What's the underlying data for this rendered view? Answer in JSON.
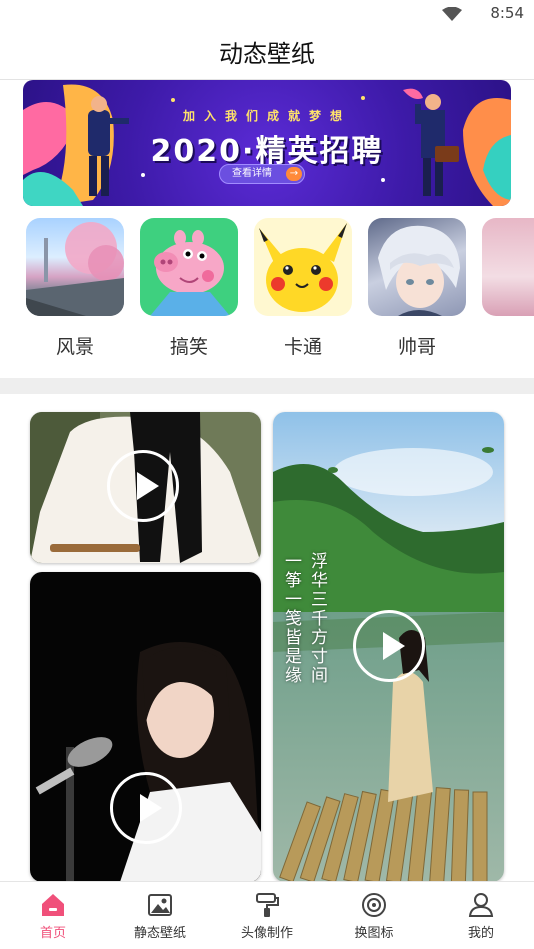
{
  "status_bar": {
    "time": "8:54"
  },
  "header": {
    "title": "动态壁纸"
  },
  "banner": {
    "subtitle": "加入我们成就梦想",
    "headline": "2020·精英招聘",
    "button_label": "查看详情"
  },
  "categories": [
    {
      "label": "风景",
      "icon": "landscape-thumb"
    },
    {
      "label": "搞笑",
      "icon": "peppa-pig-thumb"
    },
    {
      "label": "卡通",
      "icon": "pikachu-thumb"
    },
    {
      "label": "帅哥",
      "icon": "anime-boy-thumb"
    }
  ],
  "feed": {
    "poem_right": "一筝一笺皆是缘",
    "poem_left": "浮华三千方寸间"
  },
  "bottom_nav": [
    {
      "label": "首页",
      "icon": "home-icon",
      "active": true,
      "color": "#f0507a"
    },
    {
      "label": "静态壁纸",
      "icon": "image-icon"
    },
    {
      "label": "头像制作",
      "icon": "paint-roller-icon"
    },
    {
      "label": "换图标",
      "icon": "target-icon"
    },
    {
      "label": "我的",
      "icon": "user-icon"
    }
  ]
}
